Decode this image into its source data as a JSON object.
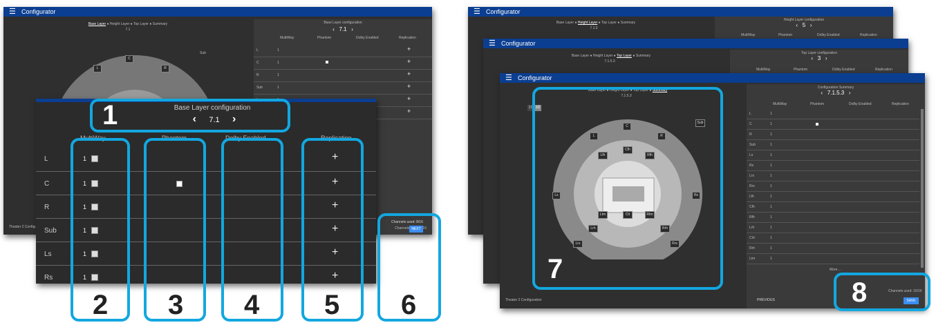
{
  "app_title": "Configurator",
  "nav_steps": [
    "Base Layer",
    "Height Layer",
    "Top Layer",
    "Summary"
  ],
  "base": {
    "panel_title": "Base Layer configuration",
    "value": "7.1",
    "columns": [
      "MultiWay",
      "Phantom",
      "Dolby Enabled",
      "Replication"
    ],
    "channels": [
      "L",
      "C",
      "R",
      "Sub",
      "Ls",
      "Rs"
    ],
    "spinner_value": "1",
    "replication_symbol": "+",
    "footer_label": "Theater 2 Configur",
    "channels_used": "Channels used: 8/16",
    "next_button": "NEXT",
    "small_channels": [
      "L",
      "C",
      "R",
      "Sub",
      "Ls",
      "Rs"
    ]
  },
  "height": {
    "panel_title": "Height Layer configuration",
    "value": "5",
    "sub": "7.1.5",
    "columns": [
      "MultiWay",
      "Phantom",
      "Dolby Enabled",
      "Replication"
    ]
  },
  "top": {
    "panel_title": "Top Layer configuration",
    "value": "3",
    "sub": "7.1.5.3",
    "columns": [
      "MultiWay",
      "Phantom",
      "Dolby Enabled",
      "Replication"
    ]
  },
  "summary": {
    "panel_title": "Configuration Summary",
    "value": "7.1.5.3",
    "columns": [
      "MultiWay",
      "Phantom",
      "Dolby Enabled",
      "Replication"
    ],
    "toggle_2d": "2D",
    "toggle_3d": "3D",
    "speakers": [
      "Sub",
      "C",
      "L",
      "R",
      "Lfh",
      "Cfh",
      "Rfh",
      "Ltm",
      "Ctt",
      "Rtm",
      "Ls",
      "Rs",
      "Lrh",
      "Rrh",
      "Lrs",
      "Rrs"
    ],
    "channels": [
      "L",
      "C",
      "R",
      "Sub",
      "Ls",
      "Rs",
      "Lrs",
      "Rrs",
      "Lfh",
      "Cfh",
      "Rfh",
      "Lrh",
      "Crh",
      "Rrh",
      "Ltm"
    ],
    "more": "More ...",
    "footer_label": "Theater 2 Configuration",
    "previous_button": "PREVIOUS",
    "channels_used": "Channels used: 16/16",
    "save_button": "SAVE"
  },
  "callouts": [
    "1",
    "2",
    "3",
    "4",
    "5",
    "6",
    "7",
    "8"
  ],
  "colors": {
    "titlebar": "#0b3e91",
    "callout": "#13a7e0",
    "button": "#3c8ef2",
    "panel": "#2f2f2f"
  }
}
